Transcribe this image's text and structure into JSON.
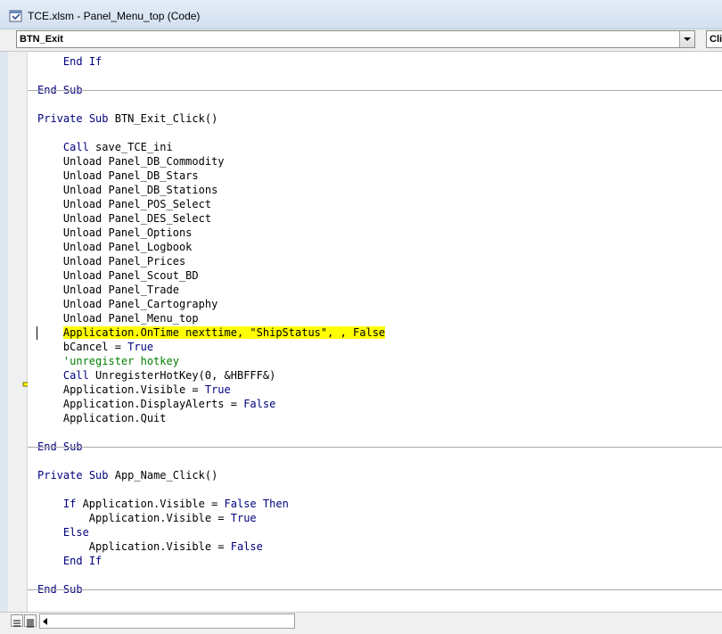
{
  "window": {
    "title": "TCE.xlsm - Panel_Menu_top (Code)"
  },
  "combos": {
    "object_value": "BTN_Exit",
    "procedure_value": "Click"
  },
  "code_lines": [
    "    End If",
    "",
    "End Sub",
    "",
    "Private Sub BTN_Exit_Click()",
    "",
    "    Call save_TCE_ini",
    "    Unload Panel_DB_Commodity",
    "    Unload Panel_DB_Stars",
    "    Unload Panel_DB_Stations",
    "    Unload Panel_POS_Select",
    "    Unload Panel_DES_Select",
    "    Unload Panel_Options",
    "    Unload Panel_Logbook",
    "    Unload Panel_Prices",
    "    Unload Panel_Scout_BD",
    "    Unload Panel_Trade",
    "    Unload Panel_Cartography",
    "    Unload Panel_Menu_top",
    "    Application.OnTime nexttime, \"ShipStatus\", , False",
    "    bCancel = True",
    "    'unregister hotkey",
    "    Call UnregisterHotKey(0, &HBFFF&)",
    "    Application.Visible = True",
    "    Application.DisplayAlerts = False",
    "    Application.Quit",
    "",
    "End Sub",
    "",
    "Private Sub App_Name_Click()",
    "",
    "    If Application.Visible = False Then",
    "        Application.Visible = True",
    "    Else",
    "        Application.Visible = False",
    "    End If",
    "",
    "End Sub"
  ],
  "highlighted_line": 19,
  "colors": {
    "keyword": "#00007f",
    "comment": "#007f00",
    "highlight": "#ffff00"
  },
  "icons": {
    "execution_pointer": "yellow-arrow-icon",
    "procedure_view": "procedure-view-icon",
    "full_module_view": "full-module-view-icon"
  }
}
